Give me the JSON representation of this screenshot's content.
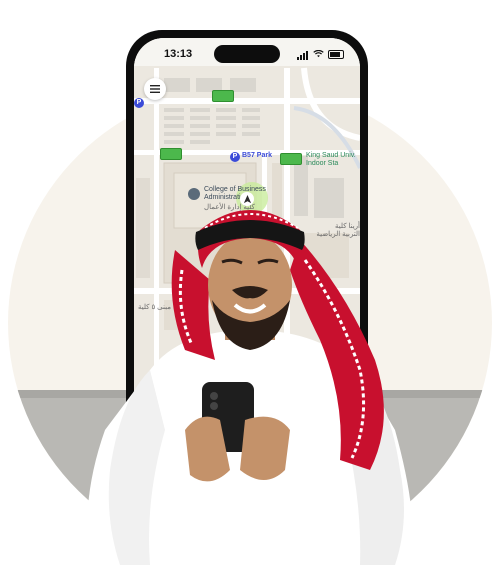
{
  "status_bar": {
    "time": "13:13"
  },
  "map": {
    "parking_label": "B57 Park",
    "building_label_en": "College of Business Administration",
    "building_label_ar": "كلية إدارة الأعمال",
    "stadium_label_en": "King Saud Univ. Indoor Sta",
    "stadium_label_ar": "أرينا كلية التربية الرياضية",
    "lower_label_ar": "مبنى ٥ كلية",
    "parking_pin_letter": "P"
  },
  "icons": {
    "menu": "hamburger-menu-icon",
    "locate": "locate-target-icon",
    "navigation": "navigation-arrow-icon"
  },
  "colors": {
    "background_circle": "#f7f3ec",
    "sofa": "#b9b8b4",
    "thobe": "#ffffff",
    "shemagh_red": "#c8102e",
    "parking_pin": "#3b4bd8",
    "car_green": "#4cb84c"
  }
}
